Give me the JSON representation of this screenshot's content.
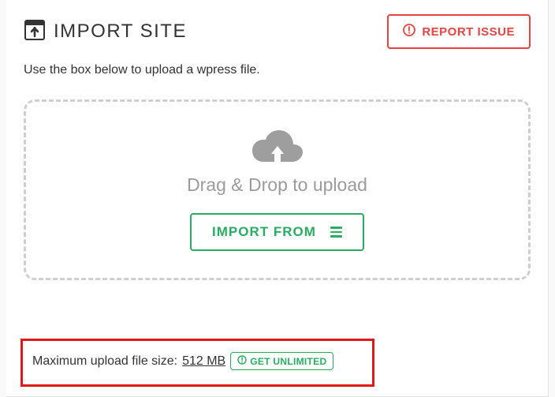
{
  "header": {
    "title": "IMPORT SITE",
    "report_label": "REPORT ISSUE"
  },
  "subtext": "Use the box below to upload a wpress file.",
  "dropzone": {
    "label": "Drag & Drop to upload",
    "import_from_label": "IMPORT FROM"
  },
  "footer": {
    "prefix": "Maximum upload file size:",
    "size": "512 MB",
    "unlimited_label": "GET UNLIMITED"
  },
  "colors": {
    "green": "#27ae60",
    "red": "#e84343",
    "highlight_border": "#e11919"
  }
}
